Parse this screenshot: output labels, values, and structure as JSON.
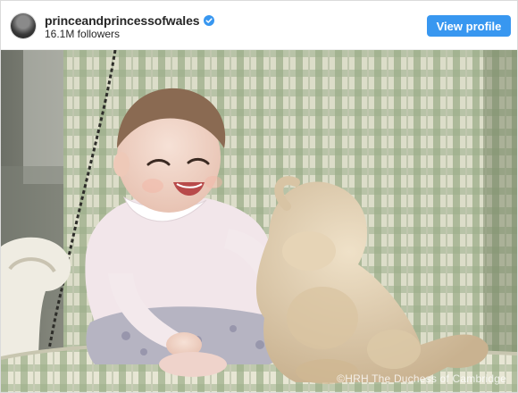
{
  "post_header": {
    "username": "princeandprincessofwales",
    "followers": "16.1M followers",
    "view_profile_label": "View profile"
  },
  "photo": {
    "credit": "©HRH The Duchess of Cambridge"
  },
  "colors": {
    "button_blue": "#3897f0",
    "verified_blue": "#3897f0",
    "text_dark": "#262626"
  },
  "icons": [
    "verified-badge-icon"
  ]
}
